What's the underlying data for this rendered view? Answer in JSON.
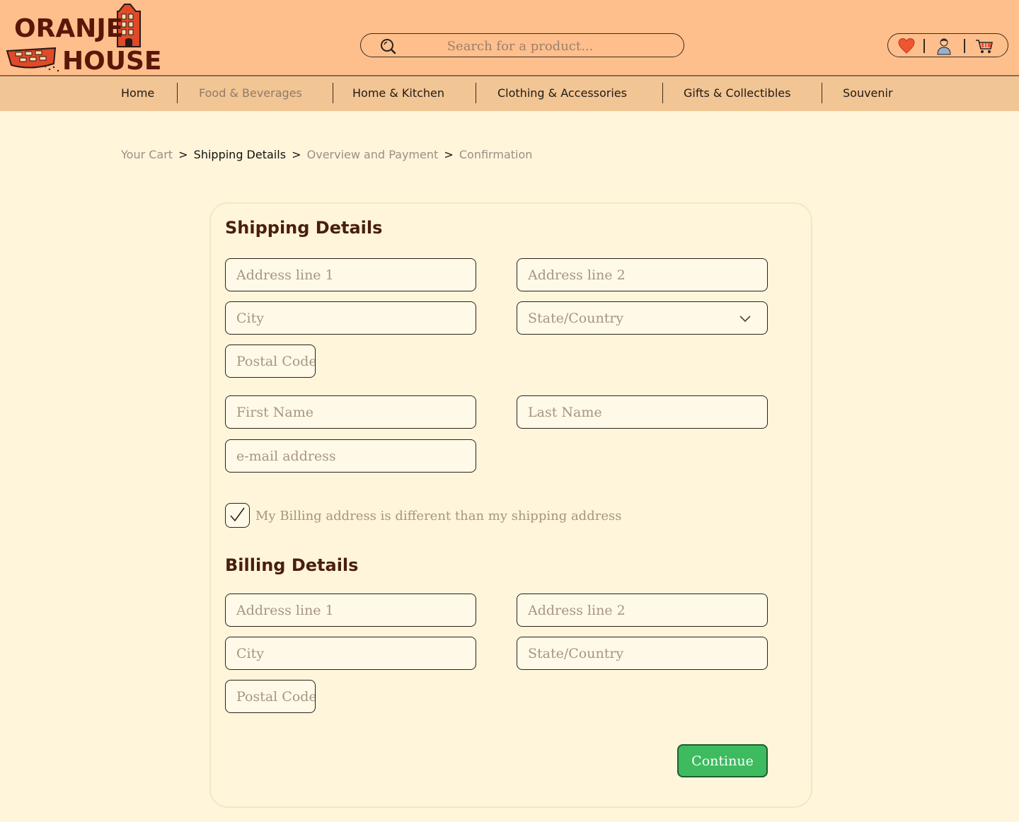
{
  "brand": {
    "line1": "ORANJE",
    "line2": "HOUSE"
  },
  "search": {
    "placeholder": "Search for a product..."
  },
  "nav": {
    "items": [
      {
        "label": "Home"
      },
      {
        "label": "Food & Beverages"
      },
      {
        "label": "Home & Kitchen"
      },
      {
        "label": "Clothing & Accessories"
      },
      {
        "label": "Gifts & Collectibles"
      },
      {
        "label": "Souvenir"
      }
    ]
  },
  "breadcrumb": {
    "steps": [
      "Your Cart",
      "Shipping Details",
      "Overview and Payment",
      "Confirmation"
    ],
    "separator": ">",
    "current": "Shipping Details"
  },
  "shipping": {
    "title": "Shipping Details",
    "address1_placeholder": "Address line 1",
    "address2_placeholder": "Address line 2",
    "city_placeholder": "City",
    "state_placeholder": "State/Country",
    "postal_placeholder": "Postal Code",
    "first_name_placeholder": "First Name",
    "last_name_placeholder": "Last Name",
    "email_placeholder": "e-mail address"
  },
  "billing_toggle": {
    "label": "My Billing address is different than my shipping address",
    "checked": true
  },
  "billing": {
    "title": "Billing Details",
    "address1_placeholder": "Address line 1",
    "address2_placeholder": "Address line 2",
    "city_placeholder": "City",
    "state_placeholder": "State/Country",
    "postal_placeholder": "Postal Code"
  },
  "continue_label": "Continue",
  "colors": {
    "header": "#ffbf8c",
    "nav": "#f2c594",
    "page": "#fef5da",
    "continue": "#3dbb5e",
    "heading": "#4a1d10"
  }
}
